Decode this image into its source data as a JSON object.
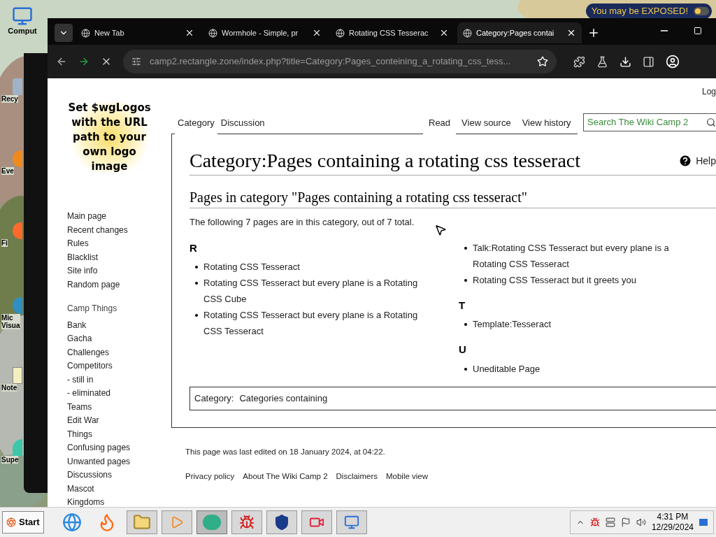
{
  "desktop": {
    "icons": [
      {
        "label": "Comput",
        "kind": "comp"
      },
      {
        "label": "Recy",
        "kind": "recycle"
      },
      {
        "label": "Eve",
        "kind": "orange"
      },
      {
        "label": "Fi",
        "kind": "fox"
      },
      {
        "label": "Mic Visua",
        "kind": "teal"
      },
      {
        "label": "Note",
        "kind": "note"
      },
      {
        "label": "Supe",
        "kind": "mint"
      }
    ],
    "alert": "You may be EXPOSED!"
  },
  "browser": {
    "tabs": [
      {
        "title": "New Tab",
        "selected": false
      },
      {
        "title": "Wormhole - Simple, pr",
        "selected": false
      },
      {
        "title": "Rotating CSS Tesserac",
        "selected": false
      },
      {
        "title": "Category:Pages contai",
        "selected": true
      }
    ],
    "address": "camp2.rectangle.zone/index.php?title=Category:Pages_conteining_a_rotating_css_tess...",
    "page": {
      "logo_text": "Set $wgLogos with the URL path to your own logo image",
      "nav": [
        "Main page",
        "Recent changes",
        "Rules",
        "Blacklist",
        "Site info",
        "Random page"
      ],
      "camp_heading": "Camp Things",
      "camp": [
        "Bank",
        "Gacha",
        "Challenges",
        "Competitors",
        "- still in",
        "- eliminated",
        "Teams",
        "Edit War",
        "Things",
        "Confusing pages",
        "Unwanted pages",
        "Discussions",
        "Mascot",
        "Kingdoms"
      ],
      "personal": "Log",
      "namespace_tabs": [
        {
          "label": "Category",
          "selected": true
        },
        {
          "label": "Discussion",
          "selected": false
        }
      ],
      "view_tabs": [
        {
          "label": "Read",
          "selected": true
        },
        {
          "label": "View source",
          "selected": false
        },
        {
          "label": "View history",
          "selected": false
        }
      ],
      "search": {
        "placeholder": "Search The Wiki Camp 2"
      },
      "title": "Category:Pages containing a rotating css tesseract",
      "help": "Help",
      "heading": "Pages in category \"Pages containing a rotating css tesseract\"",
      "intro": "The following 7 pages are in this category, out of 7 total.",
      "columns": [
        [
          {
            "letter": "R",
            "items": [
              "Rotating CSS Tesseract",
              "Rotating CSS Tesseract but every plane is a Rotating CSS Cube",
              "Rotating CSS Tesseract but every plane is a Rotating CSS Tesseract"
            ]
          }
        ],
        [
          {
            "items": [
              "Talk:Rotating CSS Tesseract but every plane is a Rotating CSS Tesseract",
              "Rotating CSS Tesseract but it greets you"
            ]
          },
          {
            "letter": "T",
            "items": [
              "Template:Tesseract"
            ]
          },
          {
            "letter": "U",
            "items": [
              "Uneditable Page"
            ]
          }
        ]
      ],
      "catlinks": {
        "label": "Category:",
        "links": [
          "Categories containing"
        ]
      },
      "last_edited": "This page was last edited on 18 January 2024, at 04:22.",
      "footer_links": [
        "Privacy policy",
        "About The Wiki Camp 2",
        "Disclaimers",
        "Mobile view"
      ]
    }
  },
  "taskbar": {
    "start": "Start",
    "time": "4:31 PM",
    "date": "12/29/2024"
  }
}
